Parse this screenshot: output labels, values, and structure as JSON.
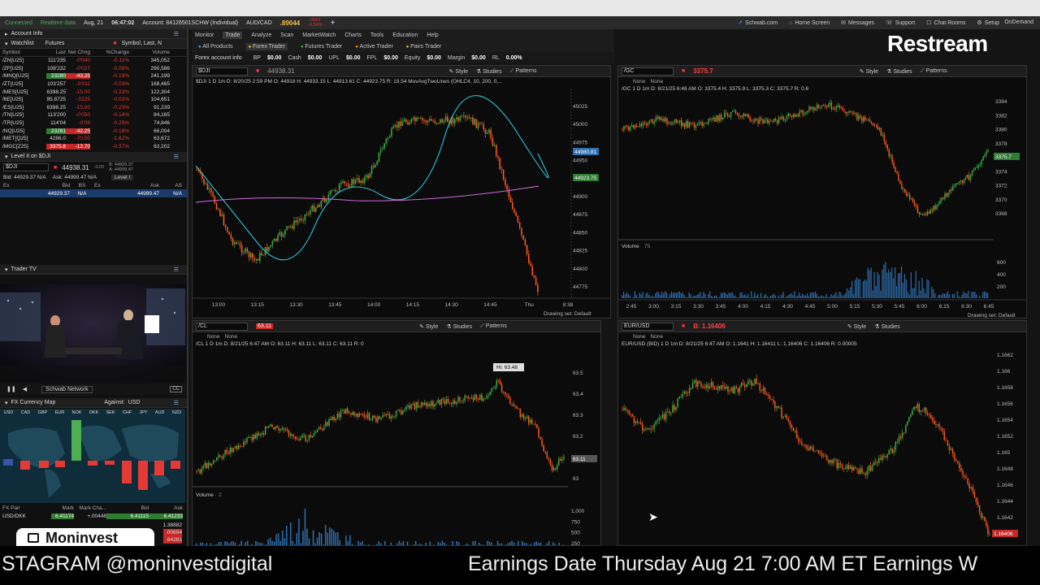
{
  "titlebar": {
    "connected": "Connected",
    "realtime": "Realtime data",
    "date": "Aug, 21",
    "time": "06:47:02",
    "account": "Account: 84126501SCHW (Individual)",
    "pair": "AUD/CAD",
    "pair_price": ".89044",
    "pair_change": "-.0021",
    "pair_pct": "-0.24%",
    "links": [
      "Schwab.com",
      "Home Screen",
      "Messages",
      "Support",
      "Chat Rooms",
      "Setup"
    ],
    "ondemand": "OnDemand"
  },
  "restream": "Restream",
  "left": {
    "account_info": "Account Info",
    "watchlist": "Watchlist",
    "futures": "Futures",
    "symbol_search": "Symbol, Last, N",
    "columns": [
      "Symbol",
      "Last",
      "Net Chng",
      "%Change",
      "Volume"
    ],
    "rows": [
      {
        "sym": "/ZN[U25]",
        "last": "111'235",
        "chg": "-0'040",
        "pct": "-0.11%",
        "vol": "345,052",
        "hl": ""
      },
      {
        "sym": "/ZF[U25]",
        "last": "108'232",
        "chg": "-0'027",
        "pct": "-0.08%",
        "vol": "290,586",
        "hl": ""
      },
      {
        "sym": "/MNQ[U25]",
        "last": "23280",
        "chg": "-43.25",
        "pct": "-0.19%",
        "vol": "241,199",
        "hl": "both"
      },
      {
        "sym": "/ZT[U25]",
        "last": "103'257",
        "chg": "-0'011",
        "pct": "-0.03%",
        "vol": "168,465",
        "hl": ""
      },
      {
        "sym": "/MES[U25]",
        "last": "6398.25",
        "chg": "-15.00",
        "pct": "-0.23%",
        "vol": "122,304",
        "hl": ""
      },
      {
        "sym": "/6E[U25]",
        "last": "95.8725",
        "chg": "-.0225",
        "pct": "-0.02%",
        "vol": "104,651",
        "hl": ""
      },
      {
        "sym": "/ES[U25]",
        "last": "6398.25",
        "chg": "-15.00",
        "pct": "-0.23%",
        "vol": "91,239",
        "hl": ""
      },
      {
        "sym": "/TN[U25]",
        "last": "113'200",
        "chg": "-0'050",
        "pct": "-0.14%",
        "vol": "84,165",
        "hl": ""
      },
      {
        "sym": "/TR[U25]",
        "last": "114'04",
        "chg": "-0'09",
        "pct": "-0.25%",
        "vol": "74,846",
        "hl": ""
      },
      {
        "sym": "/NQ[U25]",
        "last": "23281",
        "chg": "-42.25",
        "pct": "-0.18%",
        "vol": "66,004",
        "hl": "both"
      },
      {
        "sym": "/MET[Q25]",
        "last": "4286.0",
        "chg": "-70.50",
        "pct": "-1.62%",
        "vol": "63,672",
        "hl": ""
      },
      {
        "sym": "/MGC[Z25]",
        "last": "3375.8",
        "chg": "-12.70",
        "pct": "-0.37%",
        "vol": "63,202",
        "hl": "chg"
      }
    ],
    "level2_title": "Level II on $DJI",
    "l2_symbol": "$DJI",
    "l2_price": "44938.31",
    "l2_change": "-0.00",
    "l2_b": "B: 44929.37",
    "l2_a": "A: 44999.47",
    "bid_line": "Bid: 44929.37 N/A",
    "ask_line": "Ask: 44999.47 N/A",
    "level1": "Level I",
    "l2_cols": [
      "Ex",
      "Bid",
      "BS",
      "Ex",
      "Ask",
      "AS"
    ],
    "l2_row": [
      "",
      "44929.37",
      "N/A",
      "",
      "44999.47",
      "N/A"
    ],
    "trader_tv": "Trader TV",
    "network": "Schwab Network",
    "fx_title": "FX Currency Map",
    "against": "Against:",
    "against_val": "USD",
    "fx_ccys": [
      "USD",
      "CAD",
      "GBP",
      "EUR",
      "NOK",
      "DKK",
      "SEK",
      "CHF",
      "JPY",
      "AUD",
      "NZD"
    ],
    "fx_cols": [
      "FX Pair",
      "Mark",
      "Mark Cha...",
      "Bid",
      "Ask"
    ],
    "fx_row": [
      "USD/DKK",
      "6.41174",
      "+.00448",
      "6.41115",
      "6.41233"
    ],
    "fx_extra": [
      "1.38882",
      ".00694",
      ".64281"
    ],
    "moninvest": "Moninvest"
  },
  "menu": {
    "items": [
      "Monitor",
      "Trade",
      "Analyze",
      "Scan",
      "MarketWatch",
      "Charts",
      "Tools",
      "Education",
      "Help"
    ],
    "active": "Trade",
    "sub": [
      "All Products",
      "Forex Trader",
      "Futures Trader",
      "Active Trader",
      "Pairs Trader"
    ],
    "info_label": "Forex account info",
    "info": [
      [
        "BP",
        "$0.00"
      ],
      [
        "Cash",
        "$0.00"
      ],
      [
        "UPL",
        "$0.00"
      ],
      [
        "FPL",
        "$0.00"
      ],
      [
        "Equity",
        "$0.00"
      ],
      [
        "Margin",
        "$0.00"
      ],
      [
        "RL",
        "0.00%"
      ]
    ]
  },
  "charts": {
    "dji": {
      "symbol": "$DJI",
      "price": "44938.31",
      "header": "$DJI 1 D 1m  D: 8/20/25 2:59 PM  O: 44918  H: 44933.15  L: 44913.61  C: 44923.75  R: 19.54  MovAvgTwoLines (OHLC4, 10, 200, 0,...",
      "yticks": [
        "45025",
        "45000",
        "44975",
        "44950",
        "44925",
        "44900",
        "44875",
        "44850",
        "44825",
        "44800",
        "44775"
      ],
      "xticks": [
        "13:00",
        "13:15",
        "13:30",
        "13:45",
        "14:00",
        "14:15",
        "14:30",
        "14:45",
        "Thu",
        "8:38"
      ],
      "tag1": "44980.81",
      "tag2": "44923.75",
      "drawing": "Drawing set: Default"
    },
    "gc": {
      "symbol": "/GC",
      "price": "3375.7",
      "header": "/GC 1 D 1m  D: 8/21/25 6:46 AM  O: 3375.4  H: 3375.9  L: 3375.3  C: 3375.7  R: 0.6",
      "yticks": [
        "3384",
        "3382",
        "3380",
        "3378",
        "3376",
        "3374",
        "3372",
        "3370",
        "3368"
      ],
      "xticks": [
        "2:45",
        "3:00",
        "3:15",
        "3:30",
        "3:45",
        "4:00",
        "4:15",
        "4:30",
        "4:45",
        "5:00",
        "5:15",
        "5:30",
        "5:45",
        "6:00",
        "6:15",
        "6:30",
        "6:45"
      ],
      "tag": "3375.7",
      "volume_label": "Volume",
      "volume_val": "75",
      "vticks": [
        "600",
        "400",
        "200"
      ],
      "drawing": "Drawing set: Default"
    },
    "cl": {
      "symbol": "/CL",
      "price": "63.11",
      "header": "/CL 1 D 1m  D: 8/21/25 6:47 AM  O: 63.11  H: 63.11  L: 63.11  C: 63.11  R: 0",
      "yticks": [
        "63.5",
        "63.4",
        "63.3",
        "63.2",
        "63.1",
        "63"
      ],
      "hi": "Hi: 63.48",
      "tag": "63.11",
      "volume_label": "Volume",
      "volume_val": "2",
      "vticks": [
        "1,000",
        "750",
        "500",
        "250"
      ]
    },
    "eur": {
      "symbol": "EUR/USD",
      "price": "B: 1.16406",
      "header": "EUR/USD (BID) 1 D 1m  D: 8/21/25 6:47 AM  O: 1.1641  H: 1.16411  L: 1.16406  C: 1.16406  R: 0.00005",
      "yticks": [
        "1.1662",
        "1.166",
        "1.1658",
        "1.1656",
        "1.1654",
        "1.1652",
        "1.165",
        "1.1648",
        "1.1646",
        "1.1644",
        "1.1642"
      ],
      "tag": "1.16406"
    },
    "tools": [
      "Style",
      "Studies",
      "Patterns"
    ],
    "bar_label": "1m",
    "none": "None"
  },
  "ticker": {
    "left": "STAGRAM @moninvestdigital",
    "right": "Earnings Date Thursday Aug 21 7:00 AM ET Earnings W"
  },
  "colors": {
    "up": "#3cb043",
    "down": "#ff5a1f",
    "accent": "#4a90e2"
  }
}
